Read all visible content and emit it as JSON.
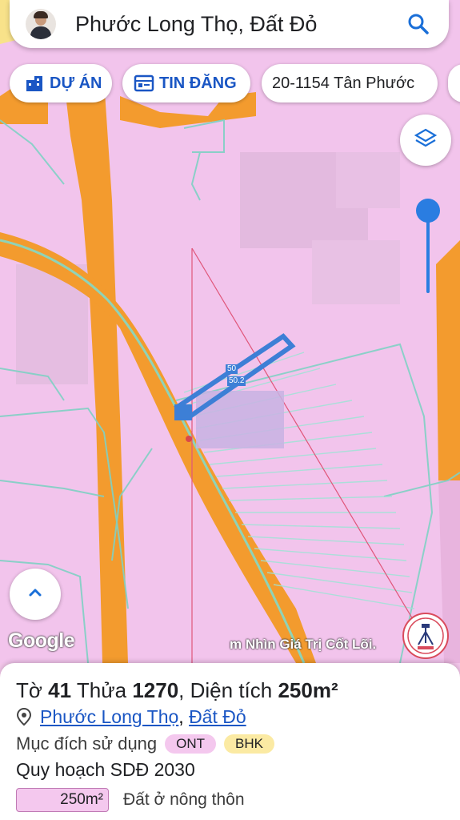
{
  "search": {
    "title": "Phước Long Thọ, Đất Đỏ",
    "avatar_icon": "user-avatar",
    "search_icon": "search-icon"
  },
  "chips": [
    {
      "label": "DỰ ÁN",
      "icon": "building-icon"
    },
    {
      "label": "TIN ĐĂNG",
      "icon": "listing-icon"
    },
    {
      "label": "20-1154 Tân Phước",
      "icon": ""
    }
  ],
  "map": {
    "dimension_labels": [
      "50",
      "50.2"
    ],
    "watermark": "m Nhìn Giá Trị Cốt Lõi.",
    "google_logo": "Google",
    "colors": {
      "residential": "#f2c4ec",
      "road": "#f39b2e",
      "parcel_lines": "#7fd1c4",
      "selected_parcel": "#3d7fd6",
      "accent_blue": "#2a7de1"
    }
  },
  "controls": {
    "layers_icon": "layers-icon",
    "expand_icon": "chevron-up-icon",
    "slider_icon": "zoom-slider"
  },
  "parcel": {
    "sheet_label": "Tờ",
    "sheet_no": "41",
    "lot_label": "Thửa",
    "lot_no": "1270",
    "area_label": "Diện tích",
    "area": "250m²",
    "ward": "Phước Long Thọ",
    "separator": ",",
    "district": "Đất Đỏ",
    "purpose_label": "Mục đích sử dụng",
    "purpose_codes": [
      "ONT",
      "BHK"
    ],
    "plan_title": "Quy hoạch SDĐ 2030",
    "plan_area": "250m²",
    "plan_description": "Đất ở nông thôn"
  }
}
